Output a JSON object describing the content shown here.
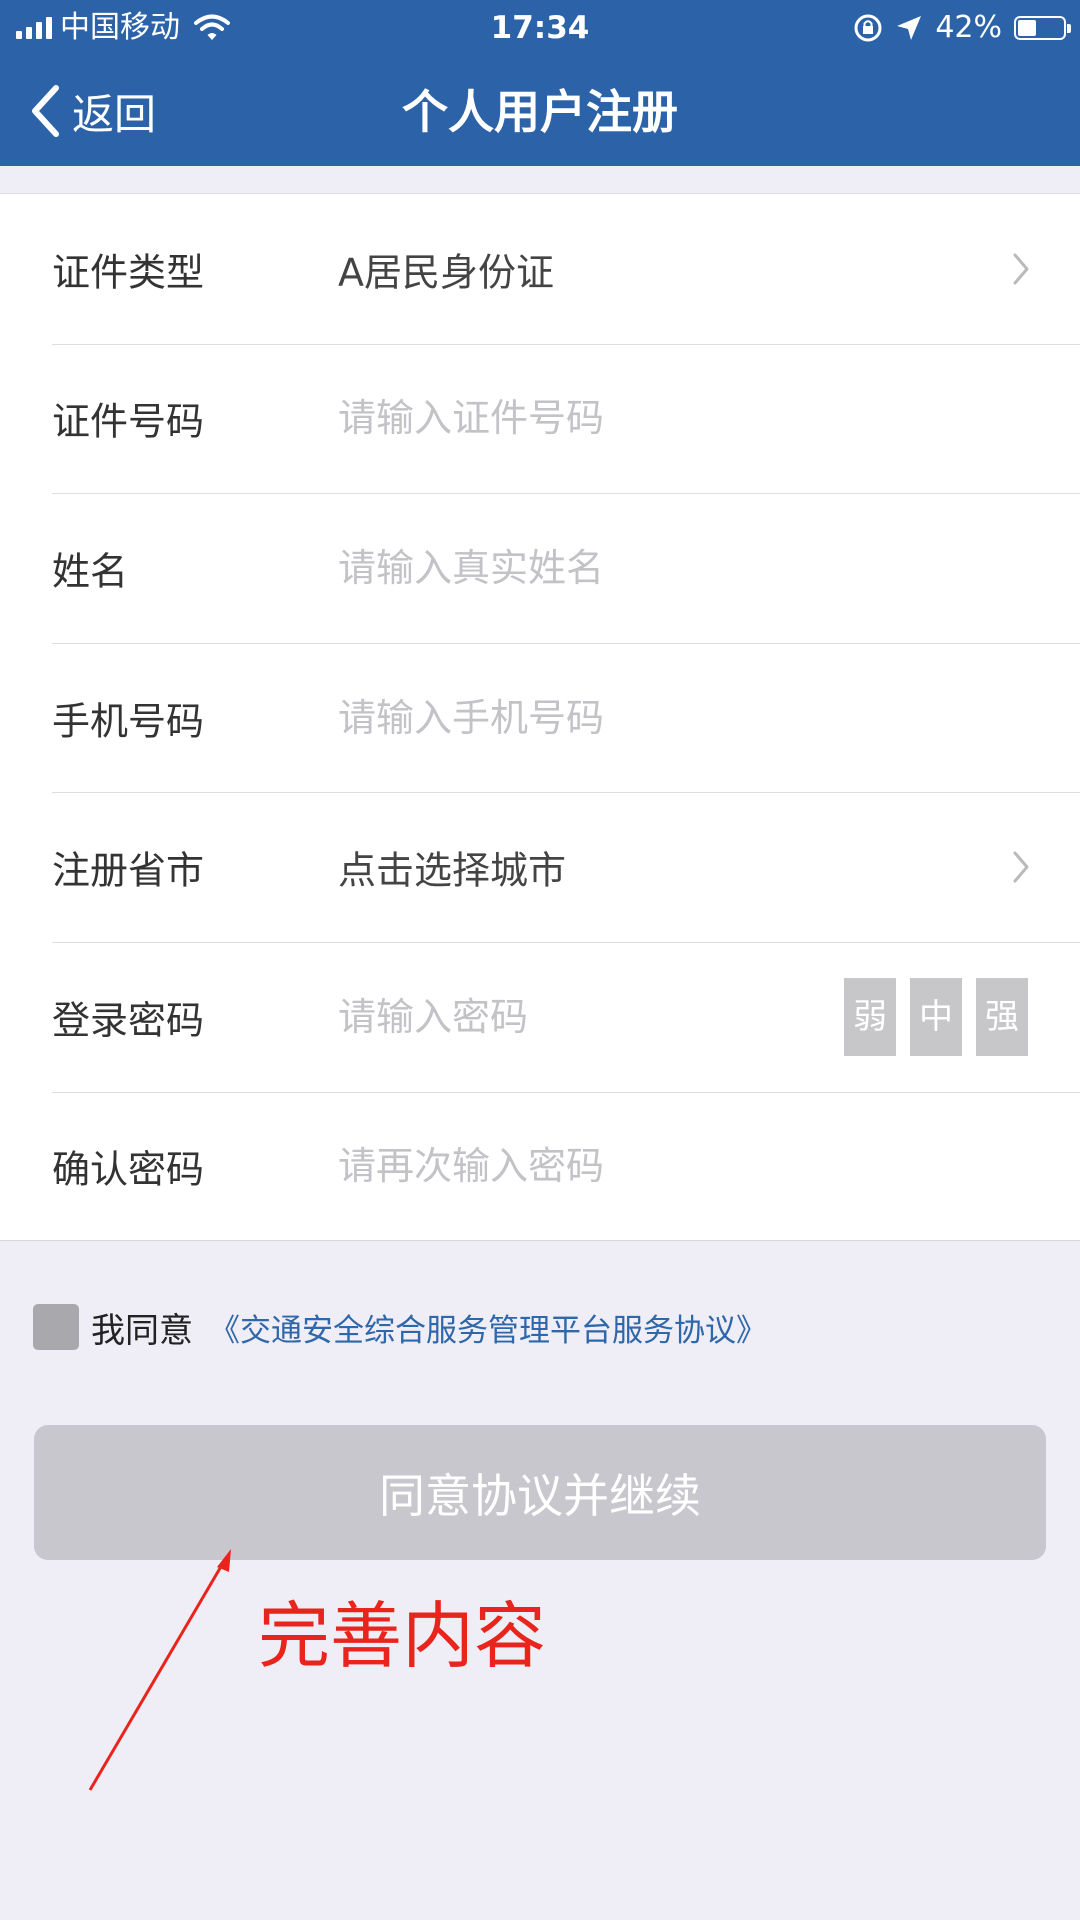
{
  "status_bar": {
    "carrier": "中国移动",
    "time": "17:34",
    "battery": "42%",
    "battery_level": 0.42
  },
  "nav": {
    "back_label": "返回",
    "title": "个人用户注册"
  },
  "form": {
    "id_type": {
      "label": "证件类型",
      "value": "A居民身份证"
    },
    "id_number": {
      "label": "证件号码",
      "placeholder": "请输入证件号码"
    },
    "name": {
      "label": "姓名",
      "placeholder": "请输入真实姓名"
    },
    "phone": {
      "label": "手机号码",
      "placeholder": "请输入手机号码"
    },
    "region": {
      "label": "注册省市",
      "value": "点击选择城市"
    },
    "password": {
      "label": "登录密码",
      "placeholder": "请输入密码",
      "strength": [
        "弱",
        "中",
        "强"
      ]
    },
    "confirm_password": {
      "label": "确认密码",
      "placeholder": "请再次输入密码"
    }
  },
  "agreement": {
    "text": "我同意",
    "link": "《交通安全综合服务管理平台服务协议》",
    "checked": false
  },
  "submit_label": "同意协议并继续",
  "annotation": {
    "text": "完善内容",
    "color": "#e8241c"
  },
  "colors": {
    "header": "#2c63a8",
    "link": "#2e67aa",
    "button_disabled": "#c8c7cd"
  }
}
